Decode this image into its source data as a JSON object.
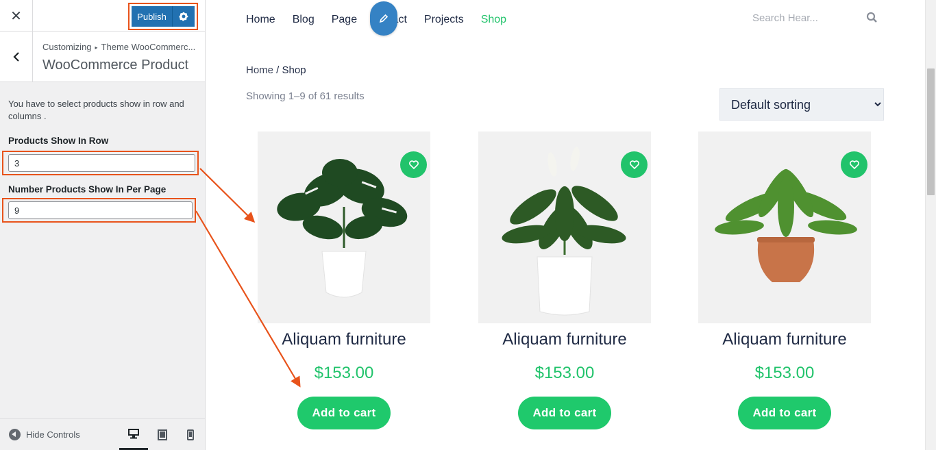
{
  "sidebar": {
    "close_glyph": "✕",
    "publish_label": "Publish",
    "breadcrumb_root": "Customizing",
    "breadcrumb_sep": "▸",
    "breadcrumb_parent": "Theme WooCommerc...",
    "section_title": "WooCommerce Product",
    "description": "You have to select products show in row and columns .",
    "fields": [
      {
        "label": "Products Show In Row",
        "value": "3"
      },
      {
        "label": "Number Products Show In Per Page",
        "value": "9"
      }
    ],
    "footer": {
      "hide_controls_label": "Hide Controls"
    },
    "accent_color": "#2271b1",
    "highlight_color": "#e8531b"
  },
  "preview": {
    "nav": {
      "items": [
        {
          "label": "Home"
        },
        {
          "label": "Blog"
        },
        {
          "label": "Page"
        },
        {
          "label": "tact"
        },
        {
          "label": "Projects"
        },
        {
          "label": "Shop"
        }
      ],
      "active": "Shop",
      "active_color": "#21c36b"
    },
    "search": {
      "placeholder": "Search Hear..."
    },
    "breadcrumb": {
      "home": "Home",
      "sep": " / ",
      "current": "Shop"
    },
    "result_count": "Showing 1–9 of 61 results",
    "sort": {
      "selected": "Default sorting"
    },
    "products": [
      {
        "title": "Aliquam furniture",
        "price": "$153.00",
        "cart_label": "Add to cart",
        "plant": "monstera in white pot"
      },
      {
        "title": "Aliquam furniture",
        "price": "$153.00",
        "cart_label": "Add to cart",
        "plant": "peace lily in white pot"
      },
      {
        "title": "Aliquam furniture",
        "price": "$153.00",
        "cart_label": "Add to cart",
        "plant": "fern in terracotta pot"
      }
    ],
    "accent_color": "#21c36b"
  }
}
